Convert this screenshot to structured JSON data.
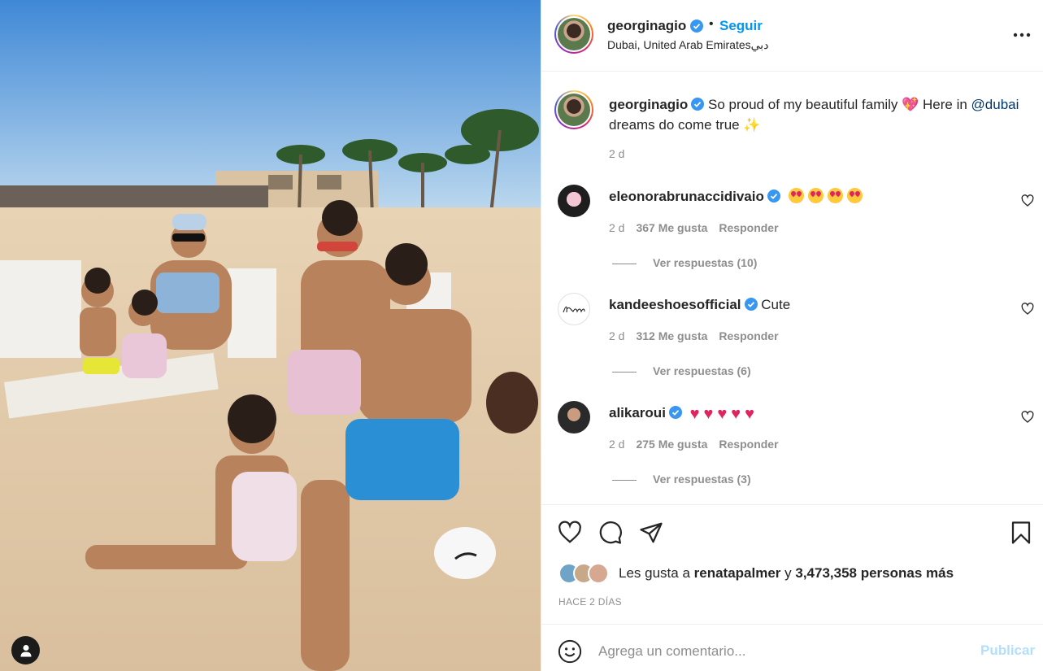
{
  "post": {
    "username": "georginagio",
    "follow_label": "Seguir",
    "separator": "•",
    "location": "Dubai, United Arab Emiratesدبي"
  },
  "caption": {
    "username": "georginagio",
    "text_before": "So proud of my beautiful family 💖 Here in ",
    "mention": "@dubai",
    "text_after": " dreams do come true ✨",
    "time": "2 d"
  },
  "comments": [
    {
      "username": "eleonorabrunaccidivaio",
      "text": "",
      "emoji_count": 4,
      "time": "2 d",
      "likes": "367 Me gusta",
      "reply_label": "Responder",
      "view_replies": "Ver respuestas (10)"
    },
    {
      "username": "kandeeshoesofficial",
      "text": "Cute",
      "time": "2 d",
      "likes": "312 Me gusta",
      "reply_label": "Responder",
      "view_replies": "Ver respuestas (6)"
    },
    {
      "username": "alikaroui",
      "text": "",
      "heart_count": 5,
      "time": "2 d",
      "likes": "275 Me gusta",
      "reply_label": "Responder",
      "view_replies": "Ver respuestas (3)"
    }
  ],
  "likes": {
    "prefix": "Les gusta a ",
    "user": "renatapalmer",
    "connector": " y ",
    "count": "3,473,358 personas más"
  },
  "time_ago": "HACE 2 DÍAS",
  "comment_box": {
    "placeholder": "Agrega un comentario...",
    "post_label": "Publicar"
  },
  "icons": {
    "like": "heart-icon",
    "comment": "comment-icon",
    "share": "paper-plane-icon",
    "save": "bookmark-icon",
    "more": "more-options-icon",
    "emoji": "emoji-icon",
    "verified": "verified-badge-icon",
    "tag": "user-tag-icon"
  },
  "colors": {
    "accent": "#0095f6",
    "verified": "#3897f0",
    "mention": "#00376b",
    "muted": "#8e8e8e",
    "post_disabled": "#b2dffc"
  }
}
